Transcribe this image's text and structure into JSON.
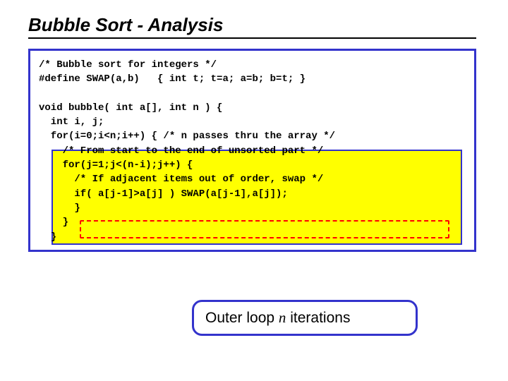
{
  "title": "Bubble Sort - Analysis",
  "code": {
    "l1": "/* Bubble sort for integers */",
    "l2": "#define SWAP(a,b)   { int t; t=a; a=b; b=t; }",
    "l3": "",
    "l4": "void bubble( int a[], int n ) {",
    "l5": "  int i, j;",
    "l6": "  for(i=0;i<n;i++) { /* n passes thru the array */",
    "l7": "    /* From start to the end of unsorted part */",
    "l8": "    for(j=1;j<(n-i);j++) {",
    "l9": "      /* If adjacent items out of order, swap */",
    "l10": "      if( a[j-1]>a[j] ) SWAP(a[j-1],a[j]);",
    "l11": "      }",
    "l12": "    }",
    "l13": "  }"
  },
  "callout": {
    "prefix": "Outer loop ",
    "var": "n",
    "suffix": " iterations"
  }
}
